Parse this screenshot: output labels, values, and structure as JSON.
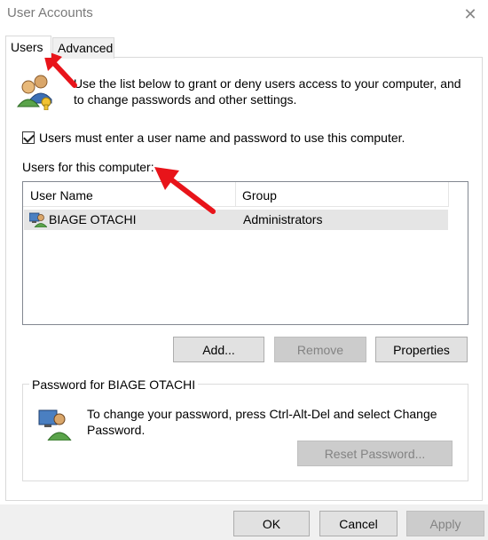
{
  "window": {
    "title": "User Accounts"
  },
  "tabs": [
    {
      "label": "Users"
    },
    {
      "label": "Advanced"
    }
  ],
  "intro": {
    "text": "Use the list below to grant or deny users access to your computer, and to change passwords and other settings."
  },
  "checkbox": {
    "label": "Users must enter a user name and password to use this computer.",
    "checked": true
  },
  "users_label": "Users for this computer:",
  "list": {
    "columns": [
      "User Name",
      "Group"
    ],
    "rows": [
      {
        "name": "BIAGE OTACHI",
        "group": "Administrators"
      }
    ]
  },
  "list_buttons": {
    "add": "Add...",
    "remove": "Remove",
    "properties": "Properties"
  },
  "password_group": {
    "title": "Password for BIAGE OTACHI",
    "text": "To change your password, press Ctrl-Alt-Del and select Change Password.",
    "reset_button": "Reset Password..."
  },
  "dialog_buttons": {
    "ok": "OK",
    "cancel": "Cancel",
    "apply": "Apply"
  },
  "colors": {
    "annotation_arrow": "#e8141a",
    "selected_row": "#e5e5e5",
    "disabled_button": "#cccccc"
  },
  "icons": [
    "users-icon",
    "user-icon",
    "password-user-icon",
    "close-icon",
    "red-arrow-icon"
  ]
}
